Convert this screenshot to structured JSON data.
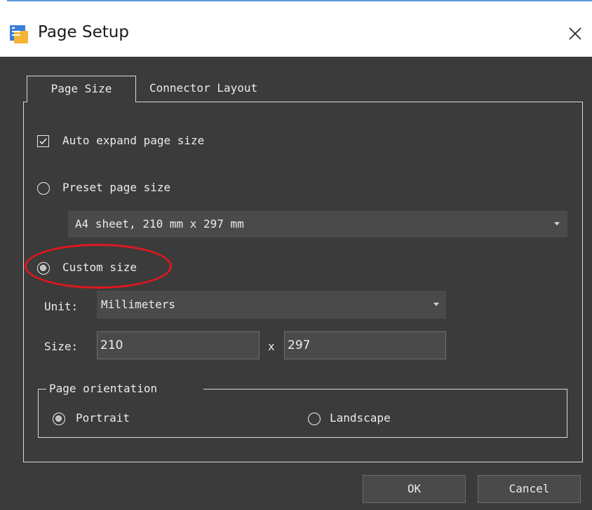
{
  "window": {
    "title": "Page Setup",
    "close_glyph": "✕",
    "app_icon": "app-logo-icon"
  },
  "tabs": [
    {
      "label": "Page Size",
      "active": true
    },
    {
      "label": "Connector Layout",
      "active": false
    }
  ],
  "auto_expand": {
    "label": "Auto expand page size",
    "checked": true
  },
  "preset": {
    "label": "Preset page size",
    "selected": false,
    "value": "A4 sheet, 210 mm x 297 mm"
  },
  "custom": {
    "label": "Custom size",
    "selected": true
  },
  "unit": {
    "label": "Unit:",
    "value": "Millimeters"
  },
  "size": {
    "label": "Size:",
    "width": "210",
    "separator": "x",
    "height": "297"
  },
  "orientation": {
    "legend": "Page orientation",
    "portrait": {
      "label": "Portrait",
      "selected": true
    },
    "landscape": {
      "label": "Landscape",
      "selected": false
    }
  },
  "buttons": {
    "ok": "OK",
    "cancel": "Cancel"
  },
  "colors": {
    "background": "#3b3b3b",
    "field": "#4a4a4a",
    "highlight": "#e0161e"
  }
}
